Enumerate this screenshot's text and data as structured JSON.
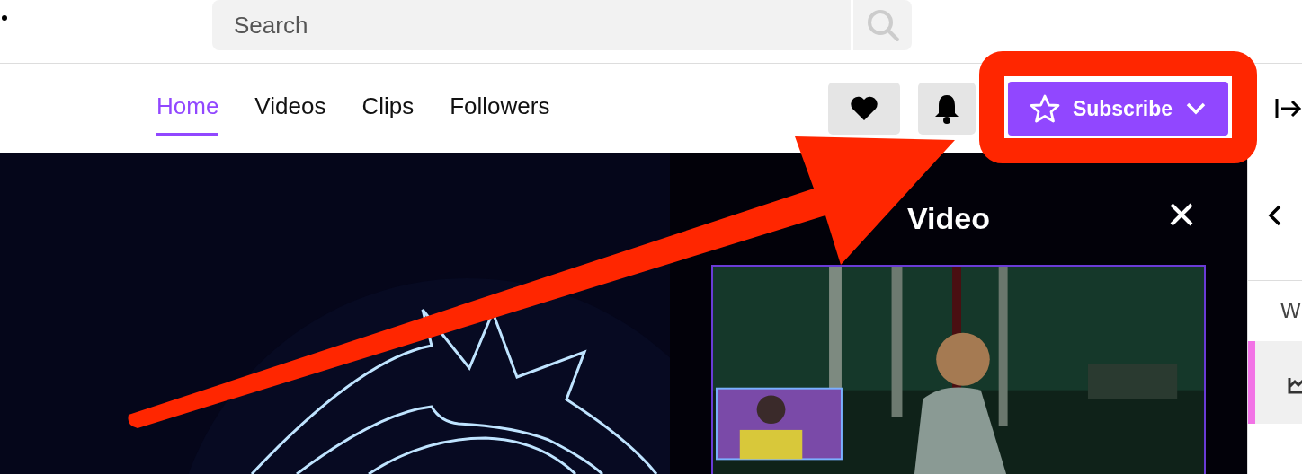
{
  "top_bar": {
    "search": {
      "placeholder": "Search"
    }
  },
  "channel_tabs": [
    {
      "label": "Home",
      "selected": true
    },
    {
      "label": "Videos",
      "selected": false
    },
    {
      "label": "Clips",
      "selected": false
    },
    {
      "label": "Followers",
      "selected": false
    }
  ],
  "subscribe_button": {
    "label": "Subscribe"
  },
  "video_panel": {
    "title": "Video"
  },
  "sidebar": {
    "items": [
      {
        "label": "W",
        "selected": false
      },
      {
        "selected": true
      }
    ]
  }
}
